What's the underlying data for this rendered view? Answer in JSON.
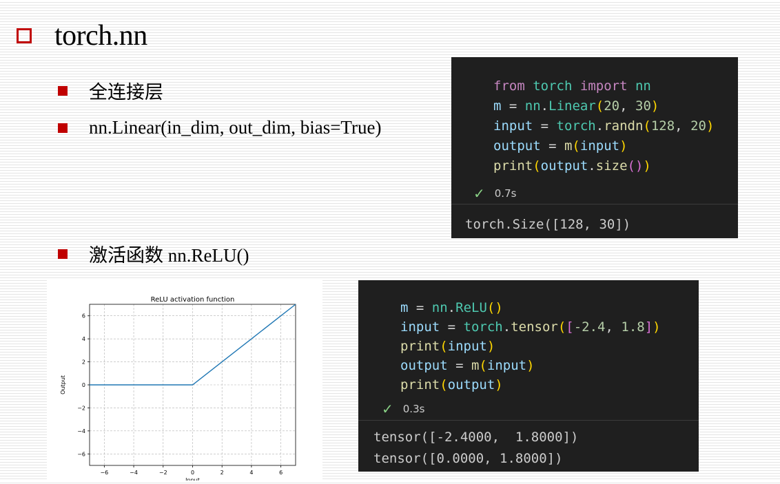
{
  "slide": {
    "title": "torch.nn",
    "bullets": [
      "全连接层",
      "nn.Linear(in_dim, out_dim, bias=True)",
      "激活函数 nn.ReLU()"
    ]
  },
  "code_panel_1": {
    "lines": [
      [
        {
          "t": "from",
          "c": "kw"
        },
        {
          "t": " ",
          "c": "op"
        },
        {
          "t": "torch",
          "c": "mod"
        },
        {
          "t": " ",
          "c": "op"
        },
        {
          "t": "import",
          "c": "kw"
        },
        {
          "t": " ",
          "c": "op"
        },
        {
          "t": "nn",
          "c": "mod"
        }
      ],
      [
        {
          "t": "m",
          "c": "var"
        },
        {
          "t": " = ",
          "c": "op"
        },
        {
          "t": "nn",
          "c": "mod"
        },
        {
          "t": ".",
          "c": "op"
        },
        {
          "t": "Linear",
          "c": "mod"
        },
        {
          "t": "(",
          "c": "p1"
        },
        {
          "t": "20",
          "c": "num"
        },
        {
          "t": ", ",
          "c": "op"
        },
        {
          "t": "30",
          "c": "num"
        },
        {
          "t": ")",
          "c": "p1"
        }
      ],
      [
        {
          "t": "input",
          "c": "var"
        },
        {
          "t": " = ",
          "c": "op"
        },
        {
          "t": "torch",
          "c": "mod"
        },
        {
          "t": ".",
          "c": "op"
        },
        {
          "t": "randn",
          "c": "fn"
        },
        {
          "t": "(",
          "c": "p1"
        },
        {
          "t": "128",
          "c": "num"
        },
        {
          "t": ", ",
          "c": "op"
        },
        {
          "t": "20",
          "c": "num"
        },
        {
          "t": ")",
          "c": "p1"
        }
      ],
      [
        {
          "t": "output",
          "c": "var"
        },
        {
          "t": " = ",
          "c": "op"
        },
        {
          "t": "m",
          "c": "fn"
        },
        {
          "t": "(",
          "c": "p1"
        },
        {
          "t": "input",
          "c": "var"
        },
        {
          "t": ")",
          "c": "p1"
        }
      ],
      [
        {
          "t": "print",
          "c": "fn"
        },
        {
          "t": "(",
          "c": "p1"
        },
        {
          "t": "output",
          "c": "var"
        },
        {
          "t": ".",
          "c": "op"
        },
        {
          "t": "size",
          "c": "fn"
        },
        {
          "t": "(",
          "c": "p2"
        },
        {
          "t": ")",
          "c": "p2"
        },
        {
          "t": ")",
          "c": "p1"
        }
      ]
    ],
    "elapsed": "0.7s",
    "output": [
      "torch.Size([128, 30])"
    ]
  },
  "code_panel_2": {
    "lines": [
      [
        {
          "t": "m",
          "c": "var"
        },
        {
          "t": " = ",
          "c": "op"
        },
        {
          "t": "nn",
          "c": "mod"
        },
        {
          "t": ".",
          "c": "op"
        },
        {
          "t": "ReLU",
          "c": "mod"
        },
        {
          "t": "(",
          "c": "p1"
        },
        {
          "t": ")",
          "c": "p1"
        }
      ],
      [
        {
          "t": "input",
          "c": "var"
        },
        {
          "t": " = ",
          "c": "op"
        },
        {
          "t": "torch",
          "c": "mod"
        },
        {
          "t": ".",
          "c": "op"
        },
        {
          "t": "tensor",
          "c": "fn"
        },
        {
          "t": "(",
          "c": "p1"
        },
        {
          "t": "[",
          "c": "p2"
        },
        {
          "t": "-2.4",
          "c": "num"
        },
        {
          "t": ", ",
          "c": "op"
        },
        {
          "t": "1.8",
          "c": "num"
        },
        {
          "t": "]",
          "c": "p2"
        },
        {
          "t": ")",
          "c": "p1"
        }
      ],
      [
        {
          "t": "print",
          "c": "fn"
        },
        {
          "t": "(",
          "c": "p1"
        },
        {
          "t": "input",
          "c": "var"
        },
        {
          "t": ")",
          "c": "p1"
        }
      ],
      [
        {
          "t": "output",
          "c": "var"
        },
        {
          "t": " = ",
          "c": "op"
        },
        {
          "t": "m",
          "c": "fn"
        },
        {
          "t": "(",
          "c": "p1"
        },
        {
          "t": "input",
          "c": "var"
        },
        {
          "t": ")",
          "c": "p1"
        }
      ],
      [
        {
          "t": "print",
          "c": "fn"
        },
        {
          "t": "(",
          "c": "p1"
        },
        {
          "t": "output",
          "c": "var"
        },
        {
          "t": ")",
          "c": "p1"
        }
      ]
    ],
    "elapsed": "0.3s",
    "output": [
      "tensor([-2.4000,  1.8000])",
      "tensor([0.0000, 1.8000])"
    ]
  },
  "colors": {
    "accent": "#c00000",
    "code_bg": "#1f1f1f",
    "keyword": "#c586c0",
    "module": "#4ec9b0",
    "function": "#dcdcaa",
    "variable": "#9cdcfe",
    "number": "#b5cea8",
    "check": "#89d185",
    "line": "#1f77b4"
  },
  "icons": {
    "title_marker": "hollow-square-icon",
    "bullet_marker": "filled-square-icon",
    "status": "checkmark-icon"
  },
  "chart_data": {
    "type": "line",
    "title": "ReLU activation function",
    "xlabel": "Input",
    "ylabel": "Output",
    "xlim": [
      -7,
      7
    ],
    "ylim": [
      -7,
      7
    ],
    "xticks": [
      -6,
      -4,
      -2,
      0,
      2,
      4,
      6
    ],
    "yticks": [
      -6,
      -4,
      -2,
      0,
      2,
      4,
      6
    ],
    "xtick_labels": [
      "−6",
      "−4",
      "−2",
      "0",
      "2",
      "4",
      "6"
    ],
    "ytick_labels": [
      "−6",
      "−4",
      "−2",
      "0",
      "2",
      "4",
      "6"
    ],
    "grid": true,
    "series": [
      {
        "x": [
          -7,
          -6,
          -4,
          -2,
          0,
          2,
          4,
          6,
          7
        ],
        "y": [
          0,
          0,
          0,
          0,
          0,
          2,
          4,
          6,
          7
        ],
        "color": "#1f77b4"
      }
    ]
  }
}
